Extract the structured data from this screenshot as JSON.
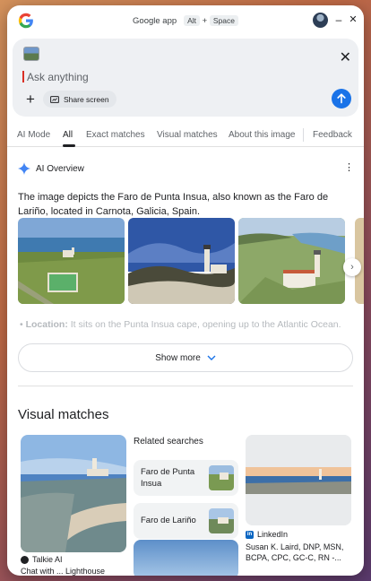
{
  "titlebar": {
    "app_name": "Google app",
    "shortcut_key1": "Alt",
    "shortcut_plus": "+",
    "shortcut_key2": "Space"
  },
  "search": {
    "placeholder": "Ask anything",
    "share_label": "Share screen"
  },
  "tabs": [
    {
      "label": "AI Mode"
    },
    {
      "label": "All",
      "active": true
    },
    {
      "label": "Exact matches"
    },
    {
      "label": "Visual matches"
    },
    {
      "label": "About this image"
    },
    {
      "label": "Feedback"
    }
  ],
  "overview": {
    "title": "AI Overview",
    "description": "The image depicts the Faro de Punta Insua, also known as the Faro de Lariño, located in Carnota, Galicia, Spain.",
    "location_label": "Location:",
    "location_text": " It sits on the Punta Insua cape, opening up to the Atlantic Ocean.",
    "show_more": "Show more"
  },
  "visual_matches": {
    "title": "Visual matches",
    "main_source": "Talkie AI",
    "main_caption": "Chat with ... Lighthouse",
    "related_title": "Related searches",
    "related": [
      {
        "label": "Faro de Punta Insua"
      },
      {
        "label": "Faro de Lariño"
      }
    ],
    "linkedin_source": "LinkedIn",
    "linkedin_caption": "Susan K. Laird, DNP, MSN, BCPA, CPC, GC-C, RN -..."
  },
  "colors": {
    "accent": "#1a73e8",
    "gemini_blue": "#4285f4",
    "linkedin": "#0a66c2"
  }
}
